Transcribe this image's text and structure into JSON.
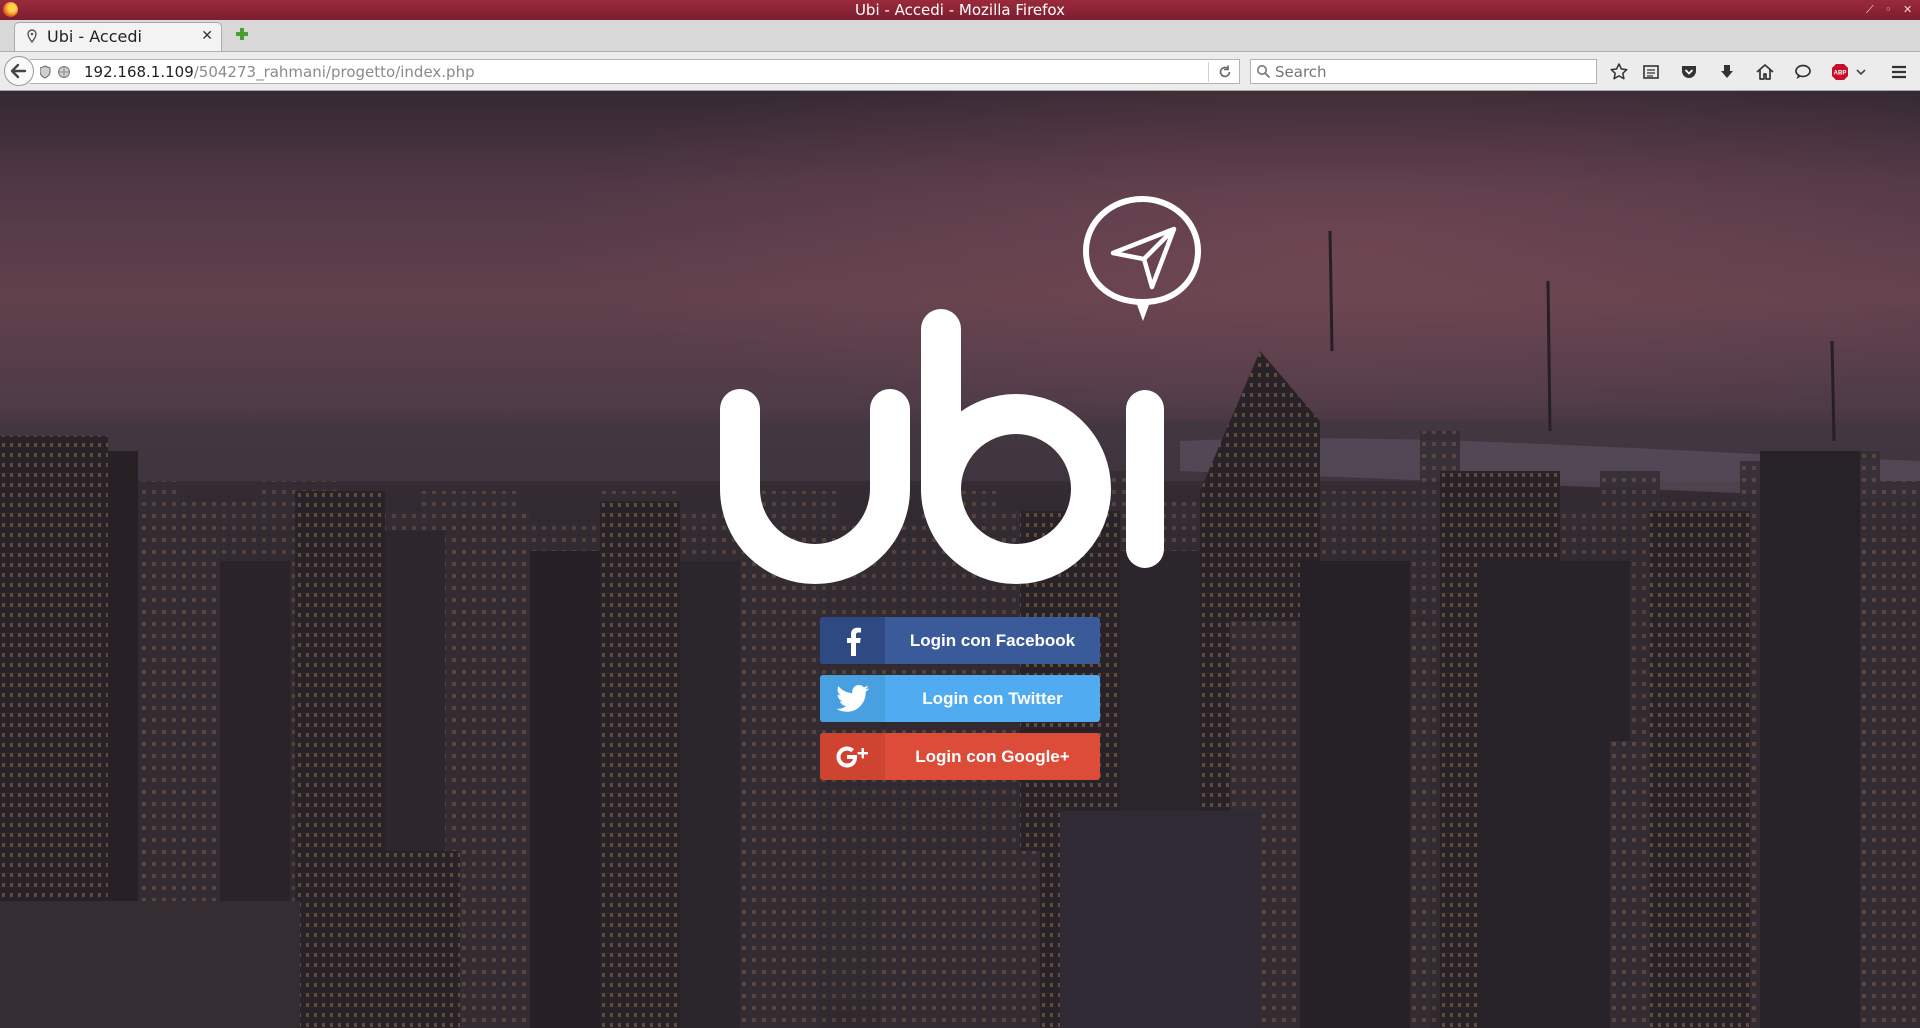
{
  "window": {
    "title": "Ubi - Accedi - Mozilla Firefox"
  },
  "tab": {
    "title": "Ubi - Accedi"
  },
  "navbar": {
    "url_host": "192.168.1.109",
    "url_path": "/504273_rahmani/progetto/index.php",
    "search_placeholder": "Search",
    "icons": [
      "bookmark-star-icon",
      "reading-list-icon",
      "pocket-icon",
      "download-icon",
      "home-icon",
      "chat-icon",
      "adblock-plus-icon",
      "menu-icon"
    ]
  },
  "logo": {
    "text": "ubi"
  },
  "login": {
    "facebook_label": "Login con Facebook",
    "twitter_label": "Login con Twitter",
    "google_label": "Login con Google+"
  },
  "colors": {
    "titlebar": "#8a2335",
    "facebook": "#3b5a99",
    "twitter": "#50abf1",
    "google": "#dd4b39"
  }
}
